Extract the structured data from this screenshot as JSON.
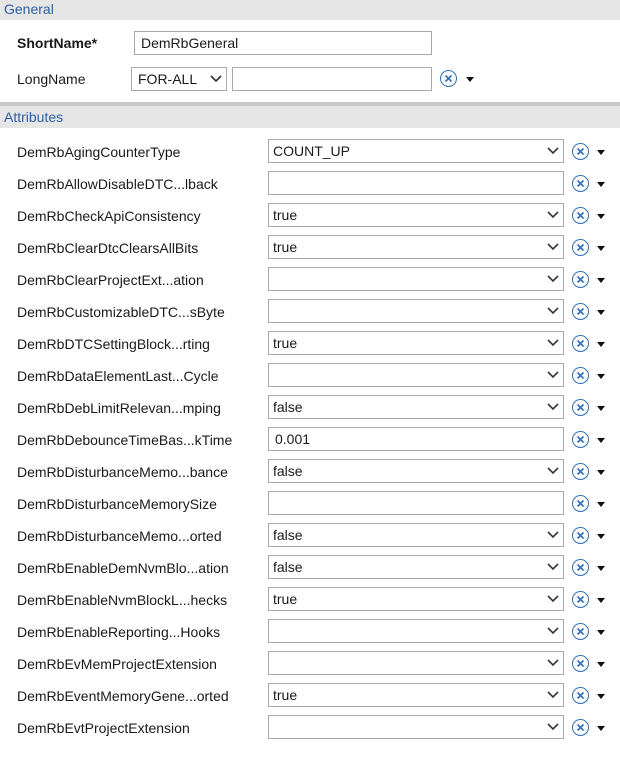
{
  "general": {
    "header": "General",
    "shortname_label": "ShortName*",
    "shortname_value": "DemRbGeneral",
    "longname_label": "LongName",
    "longname_lang": "FOR-ALL",
    "longname_value": ""
  },
  "attributes": {
    "header": "Attributes",
    "rows": [
      {
        "label": "DemRbAgingCounterType",
        "kind": "combo",
        "value": "COUNT_UP"
      },
      {
        "label": "DemRbAllowDisableDTC...lback",
        "kind": "text",
        "value": ""
      },
      {
        "label": "DemRbCheckApiConsistency",
        "kind": "combo",
        "value": "true"
      },
      {
        "label": "DemRbClearDtcClearsAllBits",
        "kind": "combo",
        "value": "true"
      },
      {
        "label": "DemRbClearProjectExt...ation",
        "kind": "combo",
        "value": ""
      },
      {
        "label": "DemRbCustomizableDTC...sByte",
        "kind": "combo",
        "value": ""
      },
      {
        "label": "DemRbDTCSettingBlock...rting",
        "kind": "combo",
        "value": "true"
      },
      {
        "label": "DemRbDataElementLast...Cycle",
        "kind": "combo",
        "value": ""
      },
      {
        "label": "DemRbDebLimitRelevan...mping",
        "kind": "combo",
        "value": "false"
      },
      {
        "label": "DemRbDebounceTimeBas...kTime",
        "kind": "text",
        "value": "0.001"
      },
      {
        "label": "DemRbDisturbanceMemo...bance",
        "kind": "combo",
        "value": "false"
      },
      {
        "label": "DemRbDisturbanceMemorySize",
        "kind": "text",
        "value": ""
      },
      {
        "label": "DemRbDisturbanceMemo...orted",
        "kind": "combo",
        "value": "false"
      },
      {
        "label": "DemRbEnableDemNvmBlo...ation",
        "kind": "combo",
        "value": "false"
      },
      {
        "label": "DemRbEnableNvmBlockL...hecks",
        "kind": "combo",
        "value": "true"
      },
      {
        "label": "DemRbEnableReporting...Hooks",
        "kind": "combo",
        "value": ""
      },
      {
        "label": "DemRbEvMemProjectExtension",
        "kind": "combo",
        "value": ""
      },
      {
        "label": "DemRbEventMemoryGene...orted",
        "kind": "combo",
        "value": "true"
      },
      {
        "label": "DemRbEvtProjectExtension",
        "kind": "combo",
        "value": ""
      }
    ]
  },
  "icons": {
    "clear": "clear-value-icon",
    "menu": "dropdown-menu-caret-icon",
    "combo_arrow": "chevron-down-icon"
  },
  "colors": {
    "header_text": "#2f5fa8",
    "header_bg": "#e6e6e6",
    "clear_icon": "#2f6fb8"
  }
}
